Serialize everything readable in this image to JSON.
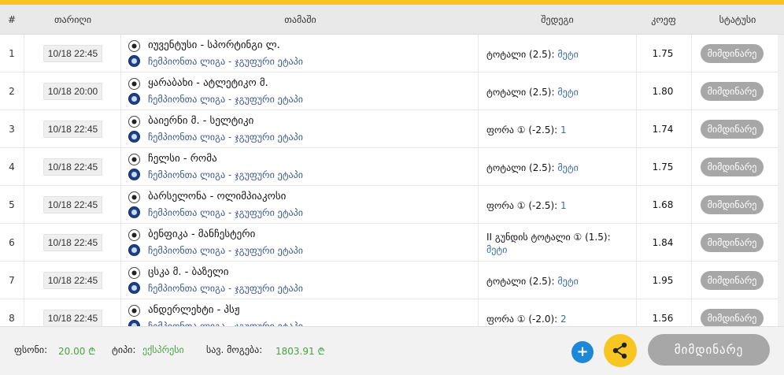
{
  "header": {
    "num": "#",
    "date": "თარიღი",
    "game": "თამაში",
    "bet": "შედეგი",
    "coef": "კოეფ",
    "status": "სტატუსი"
  },
  "rows": [
    {
      "num": "1",
      "date": "10/18 22:45",
      "game": "იუვენტუსი - სპორტინგი ლ.",
      "league": "ჩემპიონთა ლიგა - ჯგუფური ეტაპი",
      "bet_label": "ტოტალი (2.5):",
      "bet_value": "მეტი",
      "coef": "1.75",
      "status": "მიმდინარე"
    },
    {
      "num": "2",
      "date": "10/18 20:00",
      "game": "ყარაბახი - ატლეტიკო მ.",
      "league": "ჩემპიონთა ლიგა - ჯგუფური ეტაპი",
      "bet_label": "ტოტალი (2.5):",
      "bet_value": "მეტი",
      "coef": "1.80",
      "status": "მიმდინარე"
    },
    {
      "num": "3",
      "date": "10/18 22:45",
      "game": "ბაიერნი მ. - სელტიკი",
      "league": "ჩემპიონთა ლიგა - ჯგუფური ეტაპი",
      "bet_label": "ფორა ① (-2.5):",
      "bet_value": "1",
      "coef": "1.74",
      "status": "მიმდინარე"
    },
    {
      "num": "4",
      "date": "10/18 22:45",
      "game": "ჩელსი - რომა",
      "league": "ჩემპიონთა ლიგა - ჯგუფური ეტაპი",
      "bet_label": "ტოტალი (2.5):",
      "bet_value": "მეტი",
      "coef": "1.75",
      "status": "მიმდინარე"
    },
    {
      "num": "5",
      "date": "10/18 22:45",
      "game": "ბარსელონა - ოლიმპიაკოსი",
      "league": "ჩემპიონთა ლიგა - ჯგუფური ეტაპი",
      "bet_label": "ფორა ① (-2.5):",
      "bet_value": "1",
      "coef": "1.68",
      "status": "მიმდინარე"
    },
    {
      "num": "6",
      "date": "10/18 22:45",
      "game": "ბენფიკა - მანჩესტერი",
      "league": "ჩემპიონთა ლიგა - ჯგუფური ეტაპი",
      "bet_label": "II გუნდის ტოტალი ① (1.5):",
      "bet_value": "მეტი",
      "coef": "1.84",
      "status": "მიმდინარე"
    },
    {
      "num": "7",
      "date": "10/18 22:45",
      "game": "ცსკა მ. - ბაზელი",
      "league": "ჩემპიონთა ლიგა - ჯგუფური ეტაპი",
      "bet_label": "ტოტალი (2.5):",
      "bet_value": "მეტი",
      "coef": "1.95",
      "status": "მიმდინარე"
    },
    {
      "num": "8",
      "date": "10/18 22:45",
      "game": "ანდერლეხტი - პსჟ",
      "league": "ჩემპიონთა ლიგა - ჯგუფური ეტაპი",
      "bet_label": "ფორა ① (-2.0):",
      "bet_value": "2",
      "coef": "1.56",
      "status": "მიმდინარე"
    }
  ],
  "footer": {
    "stake_label": "ფსონი:",
    "stake_value": "20.00 ₾",
    "type_label": "ტიპი:",
    "type_value": "ექსპრესი",
    "win_label": "სავ. მოგება:",
    "win_value": "1803.91 ₾",
    "plus": "+",
    "status_button": "მიმდინარე"
  },
  "colors": {
    "accent": "#f7c623",
    "blue_button": "#1d88d8",
    "status_gray": "#a7a7a7",
    "value_green": "#47a344",
    "link_blue": "#3b6aa6"
  },
  "icons": [
    "soccer-ball-icon",
    "champions-league-icon",
    "share-icon",
    "plus-icon"
  ]
}
